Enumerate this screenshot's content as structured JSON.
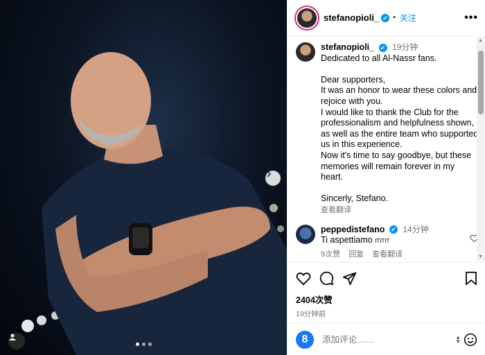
{
  "post_header": {
    "username": "stefanopioli_",
    "verified_mark": "✔",
    "separator": "•",
    "follow_label": "关注",
    "more_label": "•••"
  },
  "caption": {
    "username": "stefanopioli_",
    "time": "19分钟",
    "text": "Dedicated to all Al-Nassr fans.\n\nDear supporters,\nIt was an honor to wear these colors and rejoice with you.\nI would like to thank the Club for the professionalism and helpfulness shown, as well as the entire team who supported us in this experience.\nNow it's time to say goodbye, but these memories will remain forever in my heart.\n\nSincerly, Stefano.",
    "translate_label": "查看翻译"
  },
  "comment": {
    "username": "peppedistefano",
    "time": "14分钟",
    "text": "Ti aspettiamo",
    "flags": "ITITIT",
    "likes": "9次赞",
    "reply_label": "回复",
    "translate_label": "查看翻译"
  },
  "stats": {
    "likes": "2404次赞",
    "ago": "19分钟前"
  },
  "add_comment": {
    "placeholder": "添加评论……",
    "avatar_letter": "8"
  },
  "icons": {
    "like": "heart-icon",
    "comment": "comment-icon",
    "share": "share-icon",
    "save": "bookmark-icon",
    "next": "chevron-right-icon",
    "user_tag": "user-icon",
    "emoji": "emoji-icon"
  },
  "colors": {
    "accent": "#0095f6",
    "photo_bg": "#0c1523"
  }
}
